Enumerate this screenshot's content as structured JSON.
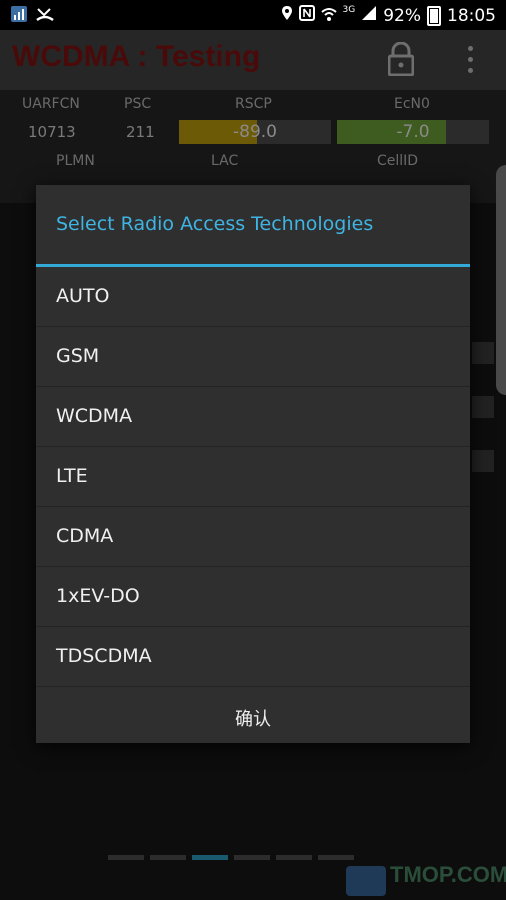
{
  "status_bar": {
    "battery": "92%",
    "time": "18:05",
    "network_type": "3G",
    "icons": [
      "app-notification-icon",
      "missed-call-icon",
      "location-icon",
      "nfc-icon",
      "wifi-icon",
      "signal-icon",
      "battery-icon"
    ]
  },
  "app": {
    "title": "WCDMA : Testing",
    "title_color": "#4a0a0a",
    "metrics": {
      "headers": [
        "UARFCN",
        "PSC",
        "RSCP",
        "EcN0"
      ],
      "values": {
        "uarfcn": "10713",
        "psc": "211",
        "rscp": "-89.0",
        "ecn0": "-7.0"
      },
      "rscp_level": 0.51,
      "ecn0_level": 0.72,
      "rscp_color": "#6d5a06",
      "ecn0_color": "#3e5c1f",
      "second_row_headers": [
        "PLMN",
        "LAC",
        "CellID"
      ]
    }
  },
  "dialog": {
    "title": "Select Radio Access Technologies",
    "accent": "#3fb4e2",
    "options": [
      "AUTO",
      "GSM",
      "WCDMA",
      "LTE",
      "CDMA",
      "1xEV-DO",
      "TDSCDMA"
    ],
    "confirm_label": "确认"
  },
  "watermark": {
    "text": "TMOP.COM"
  }
}
